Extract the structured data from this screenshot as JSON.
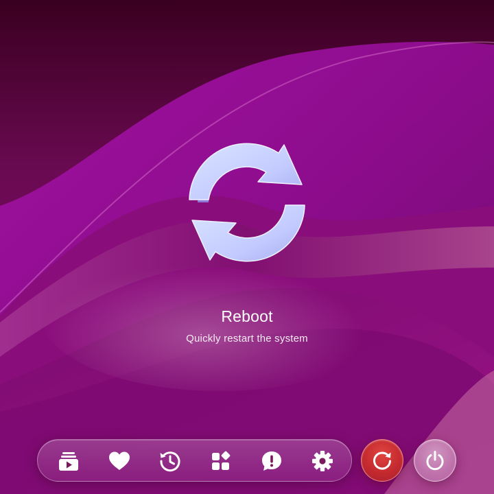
{
  "screen": {
    "title": "Reboot",
    "subtitle": "Quickly restart the system",
    "hero_icon": "refresh-arrows-icon"
  },
  "dock": {
    "items": [
      {
        "icon": "media-library-icon"
      },
      {
        "icon": "heart-icon"
      },
      {
        "icon": "history-icon"
      },
      {
        "icon": "apps-grid-icon"
      },
      {
        "icon": "alert-bubble-icon"
      },
      {
        "icon": "gear-icon"
      }
    ]
  },
  "actions": {
    "reboot": {
      "icon": "restart-icon",
      "active": true
    },
    "power": {
      "icon": "power-icon",
      "active": false
    }
  },
  "colors": {
    "accent_active": "#c42a2f",
    "icon": "#ffffff",
    "hero_icon": "#c9d4ff"
  }
}
